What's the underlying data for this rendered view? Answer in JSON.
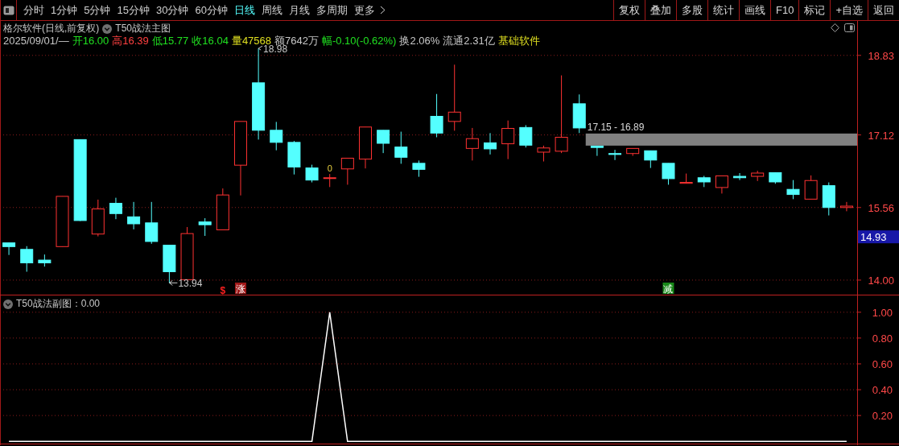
{
  "toolbar": {
    "periods": [
      {
        "label": "分时",
        "selected": false
      },
      {
        "label": "1分钟",
        "selected": false
      },
      {
        "label": "5分钟",
        "selected": false
      },
      {
        "label": "15分钟",
        "selected": false
      },
      {
        "label": "30分钟",
        "selected": false
      },
      {
        "label": "60分钟",
        "selected": false
      },
      {
        "label": "日线",
        "selected": true
      },
      {
        "label": "周线",
        "selected": false
      },
      {
        "label": "月线",
        "selected": false
      },
      {
        "label": "多周期",
        "selected": false
      },
      {
        "label": "更多",
        "selected": false
      }
    ],
    "buttons": [
      "复权",
      "叠加",
      "多股",
      "统计",
      "画线",
      "F10",
      "标记",
      "+自选",
      "返回"
    ]
  },
  "main_chart": {
    "title": "格尔软件(日线,前复权)",
    "indicator": "T50战法主图",
    "quote": [
      {
        "text": "2025/09/01/—",
        "color": "#c8c8c8"
      },
      {
        "text": "开16.00",
        "color": "#20e020"
      },
      {
        "text": "高16.39",
        "color": "#ff4040"
      },
      {
        "text": "低15.77",
        "color": "#20e020"
      },
      {
        "text": "收16.04",
        "color": "#20e020"
      },
      {
        "text": "量47568",
        "color": "#e0e020"
      },
      {
        "text": "额7642万",
        "color": "#c8c8c8"
      },
      {
        "text": "幅-0.10(-0.62%)",
        "color": "#20e020"
      },
      {
        "text": "换2.06%",
        "color": "#c8c8c8"
      },
      {
        "text": "流通2.31亿",
        "color": "#c8c8c8"
      },
      {
        "text": "基础软件",
        "color": "#e0e020"
      }
    ],
    "current_price": "14.93",
    "chart_data": {
      "type": "candlestick",
      "grid": true,
      "ylim": [
        13.67,
        19.57
      ],
      "bands": [
        {
          "axis": "y",
          "from": 16.89,
          "to": 17.15,
          "label": "17.15 - 16.89",
          "color": "#808080"
        }
      ],
      "yticks": [
        {
          "value": 18.83,
          "label": "18.83"
        },
        {
          "value": 17.12,
          "label": "17.12"
        },
        {
          "value": 15.56,
          "label": "15.56"
        },
        {
          "value": 14,
          "label": "14.00"
        }
      ],
      "ohlc": [
        [
          14.8,
          14.8,
          14.54,
          14.72
        ],
        [
          14.66,
          14.73,
          14.18,
          14.37
        ],
        [
          14.43,
          14.55,
          14.29,
          14.37
        ],
        [
          14.72,
          15.8,
          14.72,
          15.8
        ],
        [
          17.02,
          17.02,
          15.27,
          15.28
        ],
        [
          14.99,
          15.73,
          14.94,
          15.53
        ],
        [
          15.65,
          15.77,
          15.31,
          15.43
        ],
        [
          15.36,
          15.68,
          15.09,
          15.21
        ],
        [
          15.23,
          15.68,
          14.78,
          14.83
        ],
        [
          14.75,
          14.75,
          13.94,
          14.18
        ],
        [
          14.01,
          15.14,
          14.0,
          15.0
        ],
        [
          15.25,
          15.33,
          14.95,
          15.19
        ],
        [
          15.08,
          15.97,
          15.08,
          15.83
        ],
        [
          16.47,
          17.41,
          15.82,
          17.41
        ],
        [
          18.24,
          18.98,
          17.02,
          17.22
        ],
        [
          17.22,
          17.4,
          16.79,
          16.96
        ],
        [
          16.96,
          16.99,
          16.27,
          16.43
        ],
        [
          16.41,
          16.48,
          16.1,
          16.15
        ],
        [
          16.19,
          16.28,
          16.0,
          16.2
        ],
        [
          16.39,
          16.62,
          16.05,
          16.62
        ],
        [
          16.6,
          17.29,
          16.4,
          17.29
        ],
        [
          17.22,
          17.22,
          16.73,
          16.94
        ],
        [
          16.86,
          17.19,
          16.5,
          16.64
        ],
        [
          16.51,
          16.57,
          16.22,
          16.38
        ],
        [
          17.52,
          18.0,
          17.07,
          17.16
        ],
        [
          17.41,
          18.63,
          17.21,
          17.61
        ],
        [
          16.83,
          17.27,
          16.57,
          17.04
        ],
        [
          16.95,
          17.16,
          16.7,
          16.82
        ],
        [
          16.93,
          17.43,
          16.6,
          17.26
        ],
        [
          17.28,
          17.33,
          16.85,
          16.9
        ],
        [
          16.75,
          16.89,
          16.55,
          16.84
        ],
        [
          16.77,
          18.4,
          16.73,
          17.07
        ],
        [
          17.79,
          17.99,
          17.16,
          17.27
        ],
        [
          16.88,
          16.88,
          16.67,
          16.85
        ],
        [
          16.72,
          16.8,
          16.58,
          16.7
        ],
        [
          16.72,
          16.83,
          16.67,
          16.83
        ],
        [
          16.78,
          16.78,
          16.41,
          16.58
        ],
        [
          16.51,
          16.51,
          16.05,
          16.18
        ],
        [
          16.08,
          16.29,
          16.08,
          16.1
        ],
        [
          16.2,
          16.24,
          16.0,
          16.11
        ],
        [
          15.99,
          16.24,
          15.86,
          16.24
        ],
        [
          16.23,
          16.3,
          16.15,
          16.2
        ],
        [
          16.23,
          16.35,
          16.13,
          16.3
        ],
        [
          16.31,
          16.31,
          16.07,
          16.11
        ],
        [
          15.95,
          16.15,
          15.74,
          15.84
        ],
        [
          15.74,
          16.25,
          15.74,
          16.14
        ],
        [
          16.03,
          16.1,
          15.39,
          15.56
        ],
        [
          15.56,
          15.68,
          15.48,
          15.59
        ]
      ]
    },
    "annotations": [
      {
        "kind": "high",
        "text": "18.98"
      },
      {
        "kind": "low",
        "text": "13.94"
      },
      {
        "kind": "signal",
        "text": "0"
      },
      {
        "kind": "marker",
        "text": "$",
        "color": "#ff2020"
      },
      {
        "kind": "badge",
        "text": "涨",
        "color": "#a01818"
      },
      {
        "kind": "badge",
        "text": "减",
        "color": "#188818"
      }
    ]
  },
  "sub_chart": {
    "title": "T50战法副图：0.00",
    "chart_data": {
      "type": "line",
      "grid": true,
      "ylim": [
        -0.03,
        1.13
      ],
      "yticks": [
        {
          "value": 1,
          "label": "1.00"
        },
        {
          "value": 0.8,
          "label": "0.80"
        },
        {
          "value": 0.6,
          "label": "0.60"
        },
        {
          "value": 0.4,
          "label": "0.40"
        },
        {
          "value": 0.2,
          "label": "0.20"
        }
      ],
      "series": [
        {
          "color": "#ffffff",
          "values": [
            0,
            0,
            0,
            0,
            0,
            0,
            0,
            0,
            0,
            0,
            0,
            0,
            0,
            0,
            0,
            0,
            0,
            0,
            1,
            0,
            0,
            0,
            0,
            0,
            0,
            0,
            0,
            0,
            0,
            0,
            0,
            0,
            0,
            0,
            0,
            0,
            0,
            0,
            0,
            0,
            0,
            0,
            0,
            0,
            0,
            0,
            0,
            0
          ]
        }
      ]
    }
  }
}
